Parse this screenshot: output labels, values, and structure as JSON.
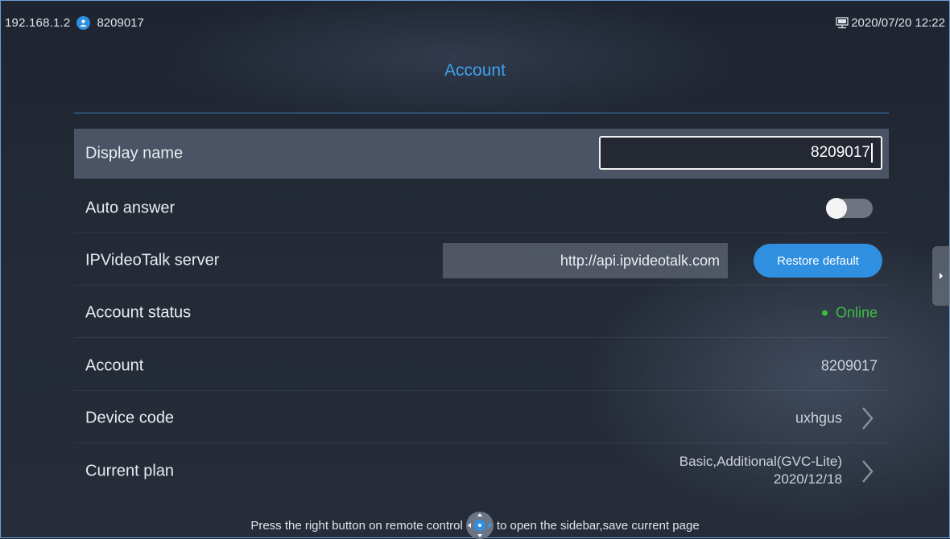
{
  "status_bar": {
    "ip": "192.168.1.2",
    "user_icon": "user-icon",
    "account_number": "8209017",
    "network_icon": "network-icon",
    "datetime": "2020/07/20 12:22"
  },
  "page": {
    "title": "Account"
  },
  "rows": {
    "display_name": {
      "label": "Display name",
      "value": "8209017"
    },
    "auto_answer": {
      "label": "Auto answer",
      "enabled": false
    },
    "server": {
      "label": "IPVideoTalk server",
      "value": "http://api.ipvideotalk.com",
      "button": "Restore default"
    },
    "account_status": {
      "label": "Account status",
      "value": "Online",
      "color": "#3fbf3f"
    },
    "account": {
      "label": "Account",
      "value": "8209017"
    },
    "device_code": {
      "label": "Device code",
      "value": "uxhgus"
    },
    "current_plan": {
      "label": "Current plan",
      "value_line1": "Basic,Additional(GVC-Lite)",
      "value_line2": "2020/12/18"
    }
  },
  "hint": {
    "before": "Press the right button on remote control",
    "after": "to open the sidebar,save current page",
    "icon": "remote-dpad-icon"
  },
  "colors": {
    "accent": "#2f8fe0",
    "title": "#3fa2ec",
    "online": "#3fbf3f"
  }
}
